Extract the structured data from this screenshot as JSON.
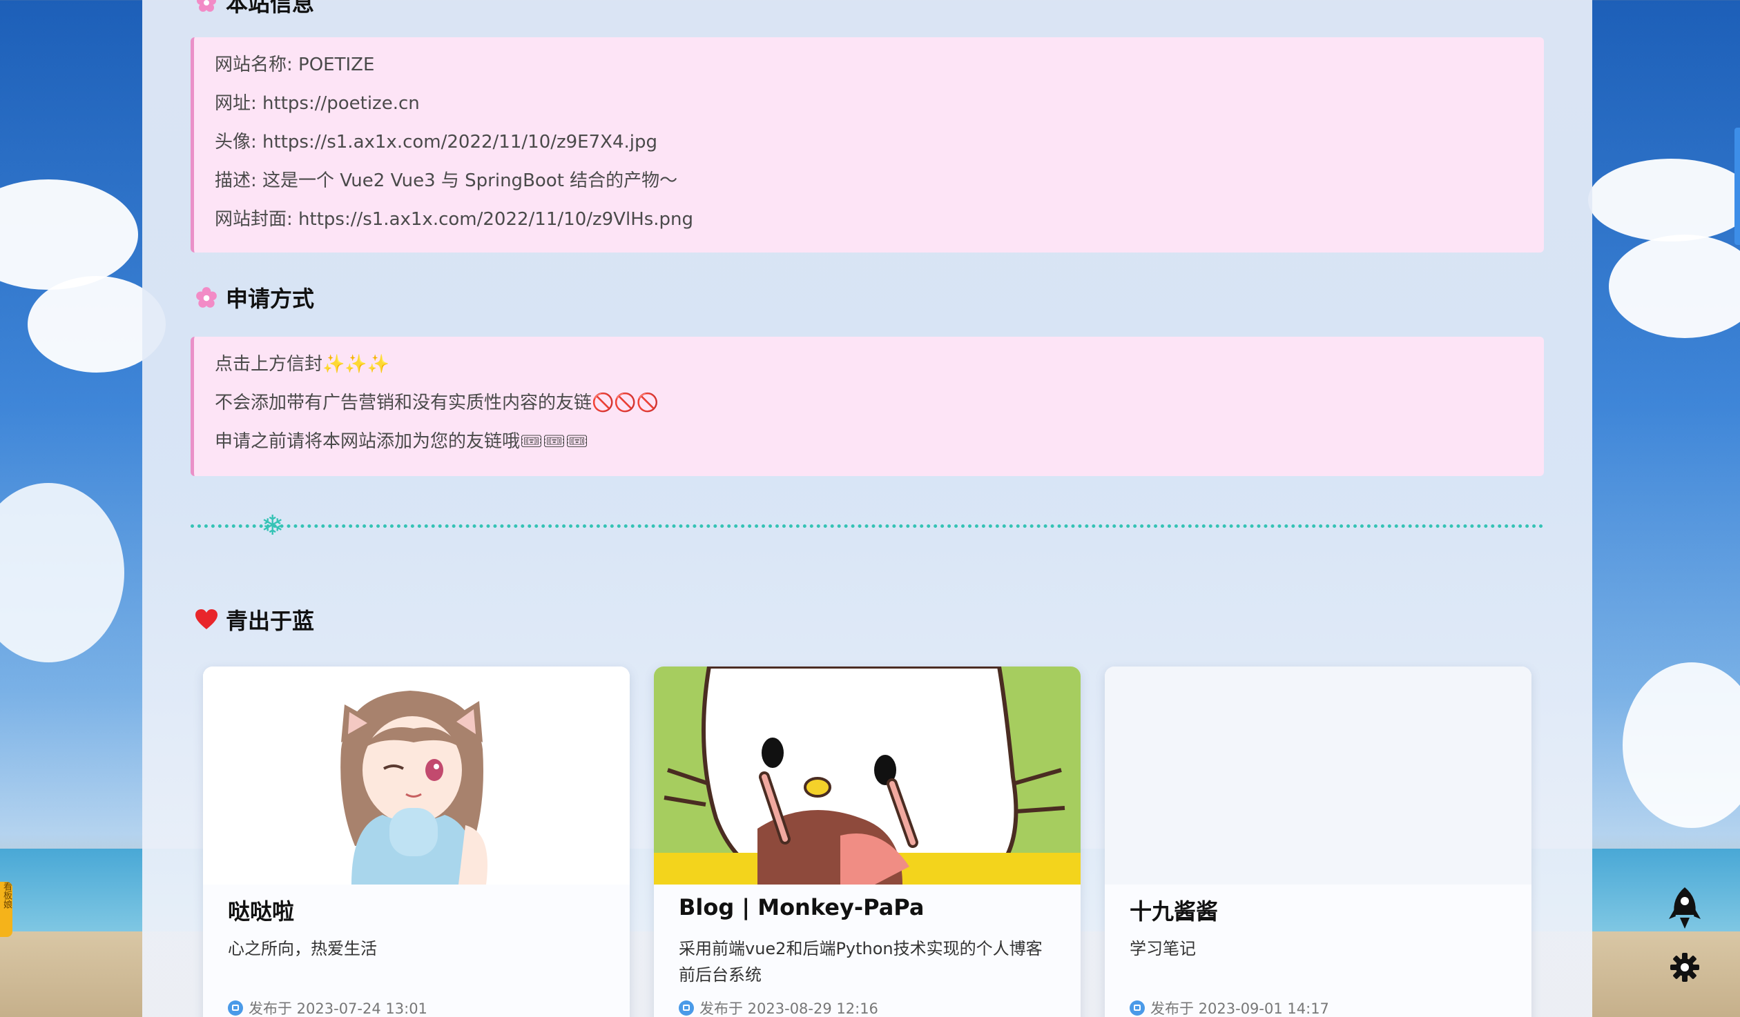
{
  "site_info": {
    "heading": "本站信息",
    "lines": [
      "网站名称: POETIZE",
      "网址: https://poetize.cn",
      "头像: https://s1.ax1x.com/2022/11/10/z9E7X4.jpg",
      "描述: 这是一个 Vue2 Vue3 与 SpringBoot 结合的产物～",
      "网站封面: https://s1.ax1x.com/2022/11/10/z9VlHs.png"
    ]
  },
  "apply": {
    "heading": "申请方式",
    "lines": [
      "点击上方信封✨✨✨",
      "不会添加带有广告营销和没有实质性内容的友链🚫🚫🚫",
      "申请之前请将本网站添加为您的友链哦🎟🎟🎟"
    ]
  },
  "divider": {
    "icon": "snowflake-icon"
  },
  "friends_section": {
    "heading": "青出于蓝",
    "icon": "heart-icon",
    "cards": [
      {
        "title": "哒哒啦",
        "description": "心之所向，热爱生活",
        "date": "发布于 2023-07-24 13:01"
      },
      {
        "title": "Blog | Monkey-PaPa",
        "description": "采用前端vue2和后端Python技术实现的个人博客前后台系统",
        "date": "发布于 2023-08-29 12:16"
      },
      {
        "title": "十九酱酱",
        "description": "学习笔记",
        "date": "发布于 2023-09-01 14:17"
      }
    ]
  },
  "side": {
    "kanban_label": "看板娘",
    "rocket_icon": "rocket-icon",
    "settings_icon": "gear-icon"
  },
  "colors": {
    "accent_pink": "#ea90c8",
    "box_bg": "#fde4f6",
    "divider": "#35c3b5",
    "sky": "#3f86d8"
  }
}
